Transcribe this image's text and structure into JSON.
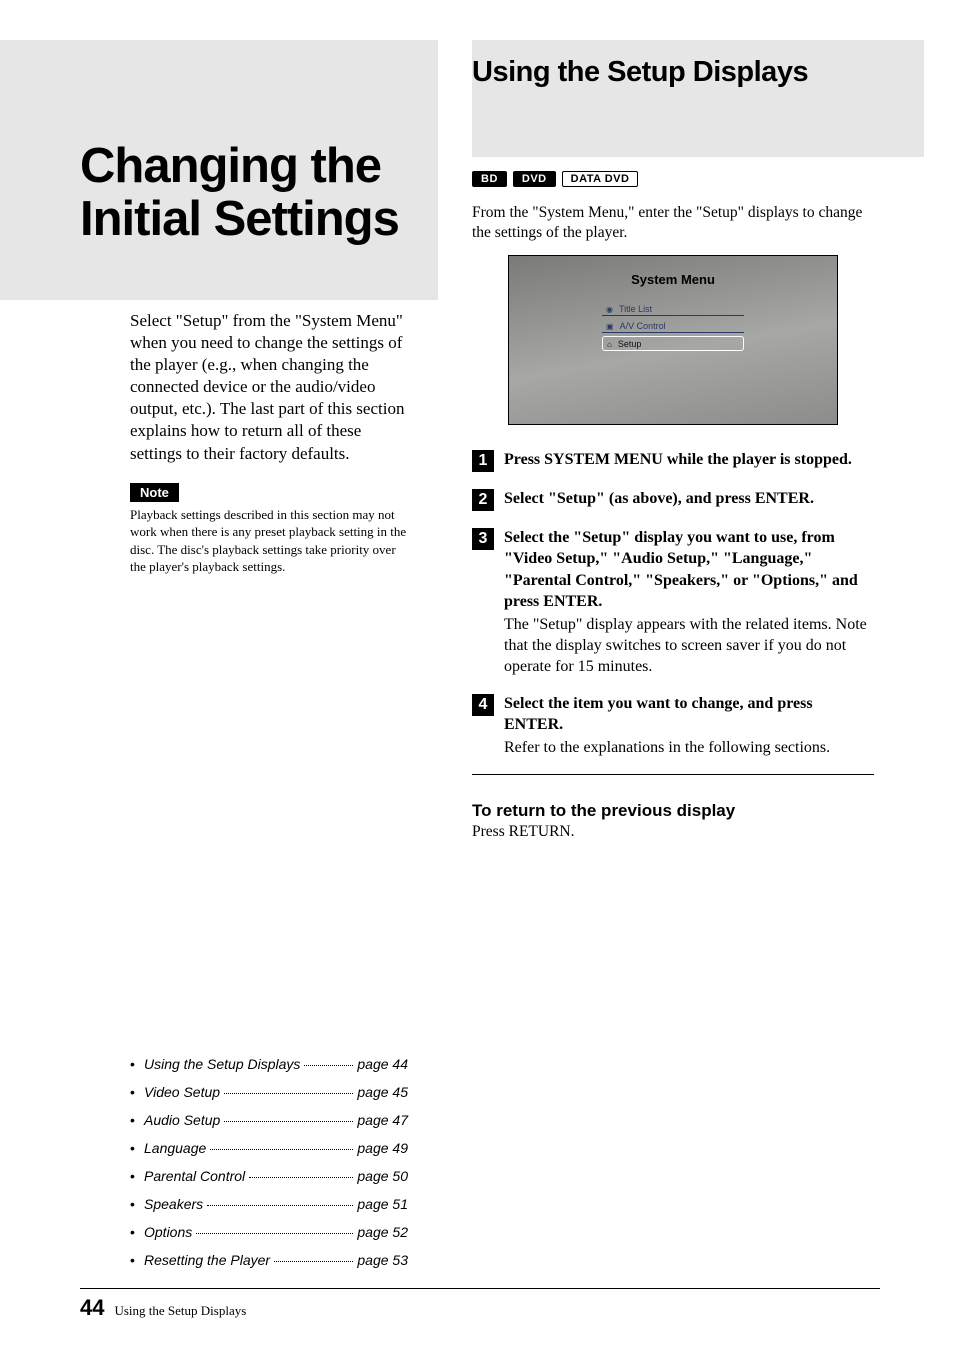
{
  "left": {
    "chapterTitle": "Changing the Initial Settings",
    "intro": "Select \"Setup\" from the \"System Menu\" when you need to change the settings of the player (e.g., when changing the connected device or the audio/video output, etc.). The last part of this section explains how to return all of these settings to their factory defaults.",
    "noteLabel": "Note",
    "noteText": "Playback settings described in this section may not work when there is any preset playback setting in the disc. The disc's playback settings take priority over the player's playback settings."
  },
  "toc": [
    {
      "label": "Using the Setup Displays",
      "page": "page 44"
    },
    {
      "label": "Video Setup",
      "page": "page 45"
    },
    {
      "label": "Audio Setup",
      "page": "page 47"
    },
    {
      "label": "Language",
      "page": "page 49"
    },
    {
      "label": "Parental Control",
      "page": "page 50"
    },
    {
      "label": "Speakers",
      "page": "page 51"
    },
    {
      "label": "Options",
      "page": "page 52"
    },
    {
      "label": "Resetting the Player",
      "page": "page 53"
    }
  ],
  "right": {
    "sectionTitle": "Using the Setup Displays",
    "badges": {
      "bd": "BD",
      "dvd": "DVD",
      "datadvd": "DATA DVD"
    },
    "intro": "From the \"System Menu,\" enter the \"Setup\" displays to change the settings of the player.",
    "screenshot": {
      "title": "System Menu",
      "items": [
        {
          "label": "Title List"
        },
        {
          "label": "A/V Control"
        },
        {
          "label": "Setup"
        }
      ]
    },
    "steps": [
      {
        "num": "1",
        "bold": "Press SYSTEM MENU while the player is stopped.",
        "plain": ""
      },
      {
        "num": "2",
        "bold": "Select \"Setup\" (as above), and press ENTER.",
        "plain": ""
      },
      {
        "num": "3",
        "bold": "Select the \"Setup\" display you want to use, from \"Video Setup,\" \"Audio Setup,\" \"Language,\" \"Parental Control,\" \"Speakers,\" or \"Options,\" and press ENTER.",
        "plain": "The \"Setup\" display appears with the related items. Note that the display switches to screen saver if you do not operate for 15 minutes."
      },
      {
        "num": "4",
        "bold": "Select the item you want to change, and press ENTER.",
        "plain": "Refer to the explanations in the following sections."
      }
    ],
    "returnHeading": "To return to the previous display",
    "returnText": "Press RETURN."
  },
  "footer": {
    "pageNum": "44",
    "text": "Using the Setup Displays"
  }
}
